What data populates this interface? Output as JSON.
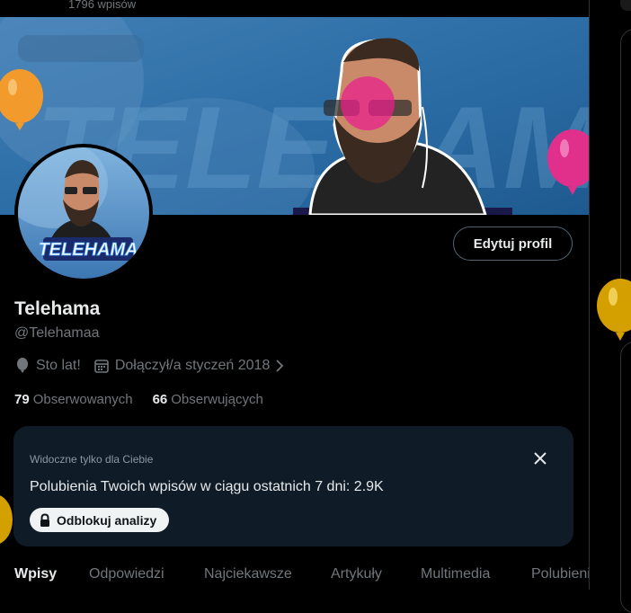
{
  "header": {
    "post_count": "1796 wpisów"
  },
  "banner": {
    "text": "TELEHAMA"
  },
  "avatar": {
    "logo_text": "TELEHAMA"
  },
  "profile": {
    "edit_label": "Edytuj profil",
    "name": "Telehama",
    "handle": "@Telehamaa",
    "birthday": "Sto lat!",
    "joined": "Dołączył/a styczeń 2018",
    "following_count": "79",
    "following_label": "Obserwowanych",
    "followers_count": "66",
    "followers_label": "Obserwujących"
  },
  "analytics": {
    "note": "Widoczne tylko dla Ciebie",
    "text": "Polubienia Twoich wpisów w ciągu ostatnich 7 dni: 2.9K",
    "button": "Odblokuj analizy"
  },
  "tabs": [
    "Wpisy",
    "Odpowiedzi",
    "Najciekawsze",
    "Artykuły",
    "Multimedia",
    "Polubienia"
  ],
  "colors": {
    "accent": "#1d9bf0",
    "panel_bg": "#0f1b27",
    "balloon_orange": "#f29b2c",
    "balloon_pink": "#e0308c",
    "balloon_gold": "#d4a000"
  },
  "icons": {
    "birthday": "balloon-icon",
    "joined": "calendar-icon",
    "close": "close-icon",
    "lock": "lock-icon",
    "chevron": "chevron-right-icon"
  }
}
